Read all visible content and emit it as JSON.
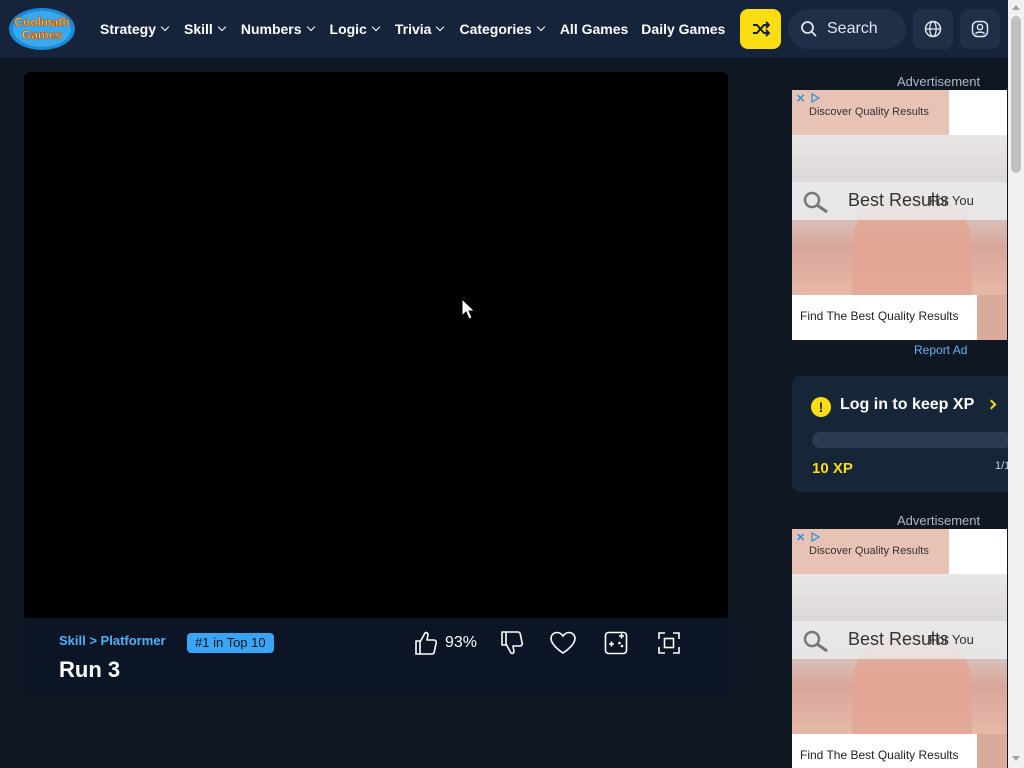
{
  "header": {
    "logo": {
      "line1": "Coolmath",
      "line2": "Games"
    },
    "nav": [
      {
        "label": "Strategy",
        "has_dropdown": true
      },
      {
        "label": "Skill",
        "has_dropdown": true
      },
      {
        "label": "Numbers",
        "has_dropdown": true
      },
      {
        "label": "Logic",
        "has_dropdown": true
      },
      {
        "label": "Trivia",
        "has_dropdown": true
      },
      {
        "label": "Categories",
        "has_dropdown": true
      },
      {
        "label": "All Games",
        "has_dropdown": false
      },
      {
        "label": "Daily Games",
        "has_dropdown": false
      }
    ],
    "search_placeholder": "Search",
    "icons": {
      "random": "shuffle-icon",
      "search": "search-icon",
      "language": "globe-icon",
      "account": "user-icon"
    }
  },
  "game": {
    "breadcrumb": "Skill > Platformer",
    "rank_badge": "#1 in Top 10",
    "title": "Run 3",
    "rating_pct": "93%"
  },
  "sidebar": {
    "ad_label": "Advertisement",
    "report_ad": "Report Ad",
    "ads": [
      {
        "top_text": "Discover Quality Results",
        "search_big": "Best Results",
        "search_small": "For You",
        "caption": "Find The Best Quality Results"
      },
      {
        "top_text": "Discover Quality Results",
        "search_big": "Best Results",
        "search_small": "For You",
        "caption": "Find The Best Quality Results"
      }
    ],
    "xp": {
      "title": "Log in to keep XP",
      "amount": "10 XP",
      "level": "1/1",
      "progress": 0
    }
  },
  "colors": {
    "header_bg": "#15243a",
    "page_bg": "#0f1722",
    "accent_yellow": "#fbdd12",
    "link_blue": "#4fb3f6"
  }
}
